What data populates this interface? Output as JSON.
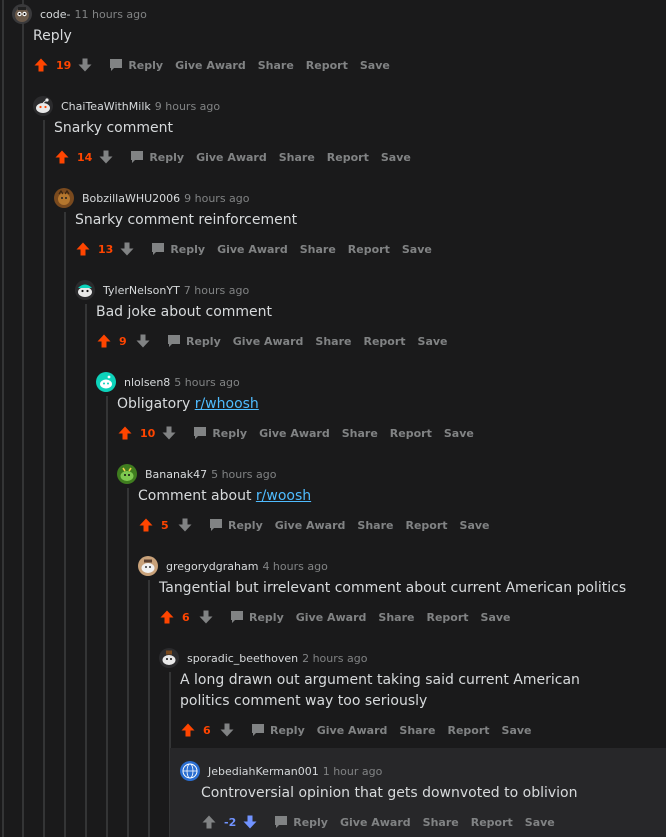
{
  "actions": {
    "reply": "Reply",
    "give_award": "Give Award",
    "share": "Share",
    "report": "Report",
    "save": "Save"
  },
  "colors": {
    "upvote": "#ff4500",
    "downvote": "#7193ff",
    "neutral": "#818384",
    "link": "#4fbcff"
  },
  "comments": [
    {
      "author": "code-",
      "time": "11 hours ago",
      "text": "Reply",
      "score": "19",
      "vote": "up"
    },
    {
      "author": "ChaiTeaWithMilk",
      "time": "9 hours ago",
      "text": "Snarky comment",
      "score": "14",
      "vote": "up"
    },
    {
      "author": "BobzillaWHU2006",
      "time": "9 hours ago",
      "text": "Snarky comment reinforcement",
      "score": "13",
      "vote": "up"
    },
    {
      "author": "TylerNelsonYT",
      "time": "7 hours ago",
      "text": "Bad joke about comment",
      "score": "9",
      "vote": "up"
    },
    {
      "author": "nlolsen8",
      "time": "5 hours ago",
      "text_before": "Obligatory ",
      "link": "r/whoosh",
      "score": "10",
      "vote": "up"
    },
    {
      "author": "Bananak47",
      "time": "5 hours ago",
      "text_before": "Comment about ",
      "link": "r/woosh",
      "score": "5",
      "vote": "up"
    },
    {
      "author": "gregorydgraham",
      "time": "4 hours ago",
      "text": "Tangential but irrelevant comment about current American politics",
      "score": "6",
      "vote": "up"
    },
    {
      "author": "sporadic_beethoven",
      "time": "2 hours ago",
      "text": "A long drawn out argument taking said current American politics comment way too seriously",
      "score": "6",
      "vote": "up"
    },
    {
      "author": "JebediahKerman001",
      "time": "1 hour ago",
      "text": "Controversial opinion that gets downvoted to oblivion",
      "score": "-2",
      "vote": "down"
    }
  ]
}
